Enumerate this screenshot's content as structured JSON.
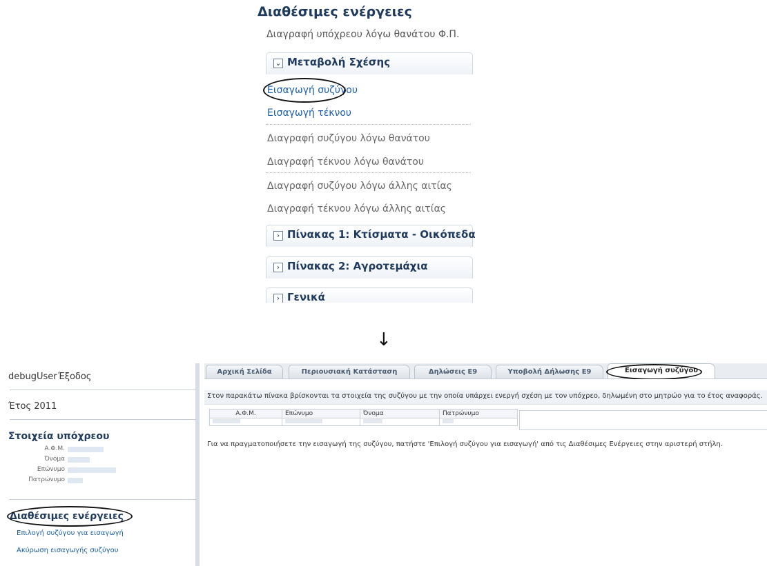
{
  "top_panel": {
    "title": "Διαθέσιμες ενέργειες",
    "subtitle": "Διαγραφή υπόχρεου λόγω θανάτου Φ.Π.",
    "sections": [
      {
        "label": "Μεταβολή Σχέσης",
        "expanded": true
      },
      {
        "label": "Πίνακας 1: Κτίσματα - Οικόπεδα",
        "expanded": false
      },
      {
        "label": "Πίνακας 2: Αγροτεμάχια",
        "expanded": false
      },
      {
        "label": "Γενικά",
        "expanded": false
      }
    ],
    "toggle_expanded_glyph": "⌄",
    "toggle_collapsed_glyph": "›",
    "menu_items": [
      {
        "label": "Εισαγωγή συζύγου",
        "state": "active",
        "highlighted": true
      },
      {
        "label": "Εισαγωγή τέκνου",
        "state": "active"
      },
      {
        "label": "Διαγραφή συζύγου λόγω θανάτου",
        "state": "disabled"
      },
      {
        "label": "Διαγραφή τέκνου λόγω θανάτου",
        "state": "disabled"
      },
      {
        "label": "Διαγραφή συζύγου λόγω άλλης αιτίας",
        "state": "disabled"
      },
      {
        "label": "Διαγραφή τέκνου λόγω άλλης αιτίας",
        "state": "disabled"
      }
    ],
    "arrow_glyph": "↓"
  },
  "sidebar": {
    "user": "debugUser",
    "logout": "Έξοδος",
    "year_label": "Έτος 2011",
    "taxpayer_heading": "Στοιχεία υπόχρεου",
    "fields": [
      {
        "label": "Α.Φ.Μ."
      },
      {
        "label": "Όνομα"
      },
      {
        "label": "Επώνυμο"
      },
      {
        "label": "Πατρώνυμο"
      }
    ],
    "actions_heading": "Διαθέσιμες ενέργειες",
    "actions": [
      {
        "label": "Επιλογή συζύγου για εισαγωγή"
      },
      {
        "label": "Ακύρωση εισαγωγής συζύγου"
      }
    ]
  },
  "tabs": [
    {
      "label": "Αρχική Σελίδα",
      "selected": false
    },
    {
      "label": "Περιουσιακή Κατάσταση",
      "selected": false
    },
    {
      "label": "Δηλώσεις Ε9",
      "selected": false
    },
    {
      "label": "Υποβολή Δήλωσης Ε9",
      "selected": false
    },
    {
      "label": "Εισαγωγή συζύγου",
      "selected": true
    }
  ],
  "main": {
    "info_text": "Στον παρακάτω πίνακα βρίσκονται τα στοιχεία της συζύγου με την οποία υπάρχει ενεργή σχέση με τον υπόχρεο, δηλωμένη στο μητρώο για το έτος αναφοράς.",
    "table_headers": [
      "Α.Φ.Μ.",
      "Επώνυμο",
      "Όνομα",
      "Πατρώνυμο"
    ],
    "help_text": "Για να πραγματοποιήσετε την εισαγωγή της συζύγου, πατήστε 'Επιλογή συζύγου για εισαγωγή' από τις Διαθέσιμες Ενέργειες στην αριστερή στήλη."
  },
  "colors": {
    "heading": "#1f3a5f",
    "link": "#1a5ea8",
    "disabled": "#666666",
    "annotation": "#111111"
  }
}
